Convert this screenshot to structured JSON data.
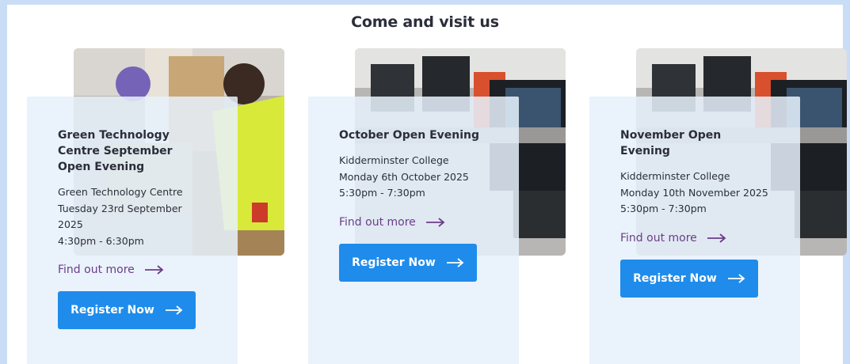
{
  "section": {
    "title": "Come and visit us"
  },
  "colors": {
    "accent": "#1f8ceb",
    "link": "#6c3d88",
    "card_bg": "#e6f1fc"
  },
  "events": [
    {
      "title": "Green Technology Centre September Open Evening",
      "details": [
        "Green Technology Centre",
        "Tuesday 23rd September 2025",
        "4:30pm - 6:30pm"
      ],
      "find_out_more": "Find out more",
      "register": "Register Now",
      "image_icon": "workshop-photo"
    },
    {
      "title": "October Open Evening",
      "details": [
        "Kidderminster College",
        "Monday 6th October 2025",
        "5:30pm - 7:30pm"
      ],
      "find_out_more": "Find out more",
      "register": "Register Now",
      "image_icon": "computer-lab-photo"
    },
    {
      "title": "November Open Evening",
      "details": [
        "Kidderminster College",
        "Monday 10th November 2025",
        "5:30pm - 7:30pm"
      ],
      "find_out_more": "Find out more",
      "register": "Register Now",
      "image_icon": "computer-lab-photo"
    }
  ]
}
